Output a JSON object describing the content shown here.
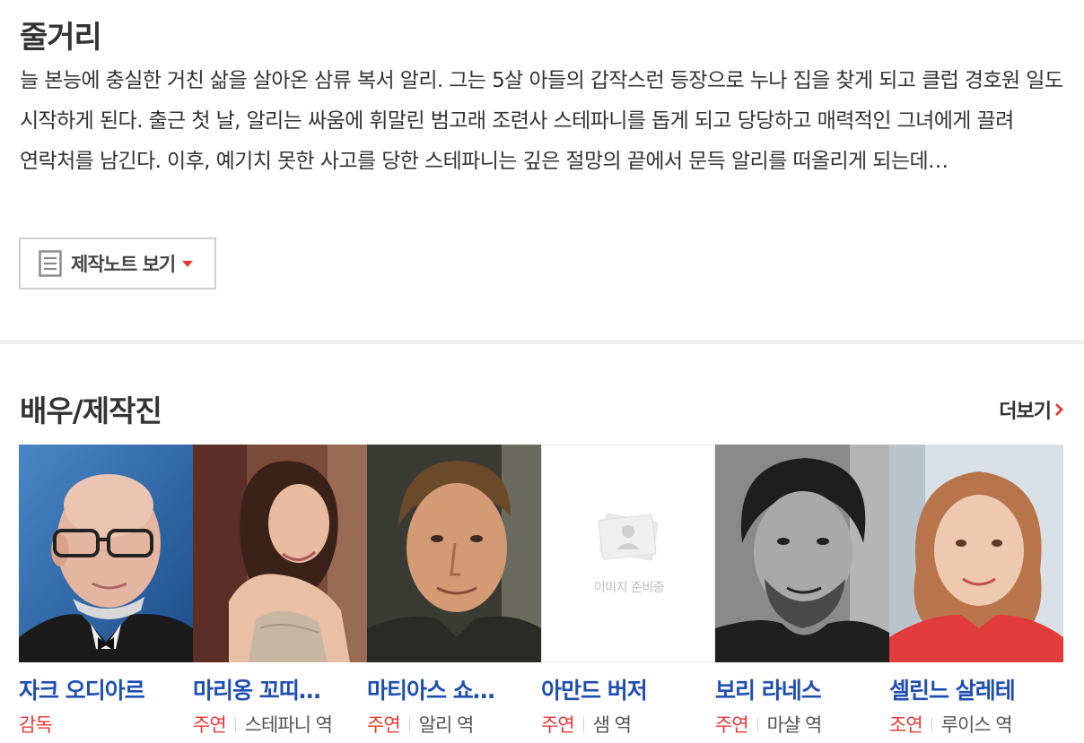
{
  "plot": {
    "title": "줄거리",
    "text": "늘 본능에 충실한 거친 삶을 살아온 삼류 복서 알리. 그는 5살 아들의 갑작스런 등장으로 누나 집을 찾게 되고 클럽 경호원 일도 시작하게 된다. 출근 첫 날, 알리는 싸움에 휘말린 범고래 조련사 스테파니를 돕게 되고 당당하고 매력적인 그녀에게 끌려 연락처를 남긴다. 이후, 예기치 못한 사고를 당한 스테파니는 깊은 절망의 끝에서 문득 알리를 떠올리게 되는데…",
    "notes_button": "제작노트 보기"
  },
  "cast": {
    "title": "배우/제작진",
    "more_label": "더보기",
    "placeholder_text": "이미지 준비중",
    "members": [
      {
        "name": "자크 오디아르",
        "role": "감독",
        "character": ""
      },
      {
        "name": "마리옹 꼬띠…",
        "role": "주연",
        "character": "스테파니 역"
      },
      {
        "name": "마티아스 쇼…",
        "role": "주연",
        "character": "알리 역"
      },
      {
        "name": "아만드 버저",
        "role": "주연",
        "character": "샘 역"
      },
      {
        "name": "보리 라네스",
        "role": "주연",
        "character": "마샬 역"
      },
      {
        "name": "셀린느 살레테",
        "role": "조연",
        "character": "루이스 역"
      }
    ]
  },
  "colors": {
    "name_link": "#1f4fb2",
    "role_accent": "#e53935",
    "caret": "#e53935"
  },
  "icons": {
    "notes": "document-icon",
    "more": "chevron-right-icon",
    "placeholder": "image-placeholder-icon"
  }
}
